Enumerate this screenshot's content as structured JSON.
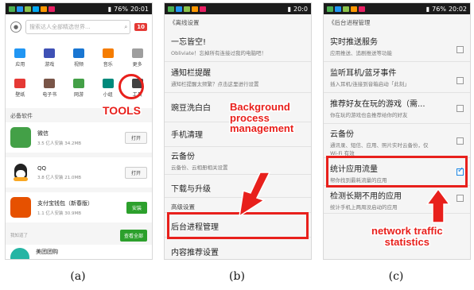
{
  "status": {
    "battery_a": "76%",
    "time_a": "20:01",
    "time_b": "20:0",
    "battery_c": "76%",
    "time_c": "20:02"
  },
  "panel_a": {
    "search_placeholder": "搜索达人全部精选世界...",
    "download_count": "10",
    "grid": [
      {
        "label": "应用",
        "icon": "app-icon",
        "color": "#2196f3"
      },
      {
        "label": "游戏",
        "icon": "game-icon",
        "color": "#3f51b5"
      },
      {
        "label": "视频",
        "icon": "video-icon",
        "color": "#1976d2"
      },
      {
        "label": "音乐",
        "icon": "music-icon",
        "color": "#f57c00"
      },
      {
        "label": "更多",
        "icon": "more-icon",
        "color": "#9e9e9e"
      },
      {
        "label": "壁纸",
        "icon": "wallpaper-icon",
        "color": "#e53935"
      },
      {
        "label": "电子书",
        "icon": "ebook-icon",
        "color": "#795548"
      },
      {
        "label": "网游",
        "icon": "netgame-icon",
        "color": "#43a047"
      },
      {
        "label": "小组",
        "icon": "group-icon",
        "color": "#00897b"
      },
      {
        "label": "工具",
        "icon": "tools-icon",
        "color": "#424242"
      }
    ],
    "section_title": "必备软件",
    "apps": [
      {
        "name": "微信",
        "meta": "3.5 亿人安装 34.2MB",
        "action": "打开",
        "icon_color": "#43a047"
      },
      {
        "name": "QQ",
        "meta": "3.8 亿人安装 21.0MB",
        "action": "打开",
        "icon_color": "#222222"
      },
      {
        "name": "支付宝钱包（新春版）",
        "meta": "1.1 亿人安装 30.9MB",
        "action": "安装",
        "icon_color": "#e65100"
      }
    ],
    "more_text": "我知道了",
    "view_all": "查看全部",
    "partial_app": "美团团购",
    "annotation": "TOOLS"
  },
  "panel_b": {
    "header": "《离线设置",
    "items": [
      {
        "title": "一忘皆空!",
        "sub": "Obliviate！忘掉所有连接过我的电脑吧！"
      },
      {
        "title": "通知栏提醒",
        "sub": "通知栏提醒太频繁？点击这里进行设置"
      },
      {
        "title": "豌豆洗白白",
        "sub": ""
      },
      {
        "title": "手机清理",
        "sub": ""
      },
      {
        "title": "云备份",
        "sub": "云备份、云相册相关设置"
      },
      {
        "title": "下载与升级",
        "sub": ""
      },
      {
        "title": "高级设置",
        "sub": ""
      },
      {
        "title": "后台进程管理",
        "sub": ""
      },
      {
        "title": "内容推荐设置",
        "sub": ""
      }
    ],
    "annotation_lines": [
      "Background",
      "process",
      "management"
    ]
  },
  "panel_c": {
    "header": "《后台进程管理",
    "items": [
      {
        "title": "实时推送服务",
        "sub": "应用推送、追剧推送等功能",
        "checked": false
      },
      {
        "title": "监听耳机/蓝牙事件",
        "sub": "插入耳机/连接到音箱启动「此刻」",
        "checked": false
      },
      {
        "title": "推荐好友在玩的游戏（需...",
        "sub": "你在玩的游戏也会推荐给你的好友",
        "checked": false
      },
      {
        "title": "云备份",
        "sub": "通讯录、短信、应用、照片实时云备份，仅 Wi-Fi 有效",
        "checked": false
      },
      {
        "title": "统计应用流量",
        "sub": "帮你找到最耗流量的应用",
        "checked": true
      },
      {
        "title": "检测长期不用的应用",
        "sub": "统计手机上两周没启动的应用",
        "checked": false
      }
    ],
    "annotation_lines": [
      "network traffic",
      "statistics"
    ]
  },
  "captions": [
    "(a)",
    "(b)",
    "(c)"
  ]
}
